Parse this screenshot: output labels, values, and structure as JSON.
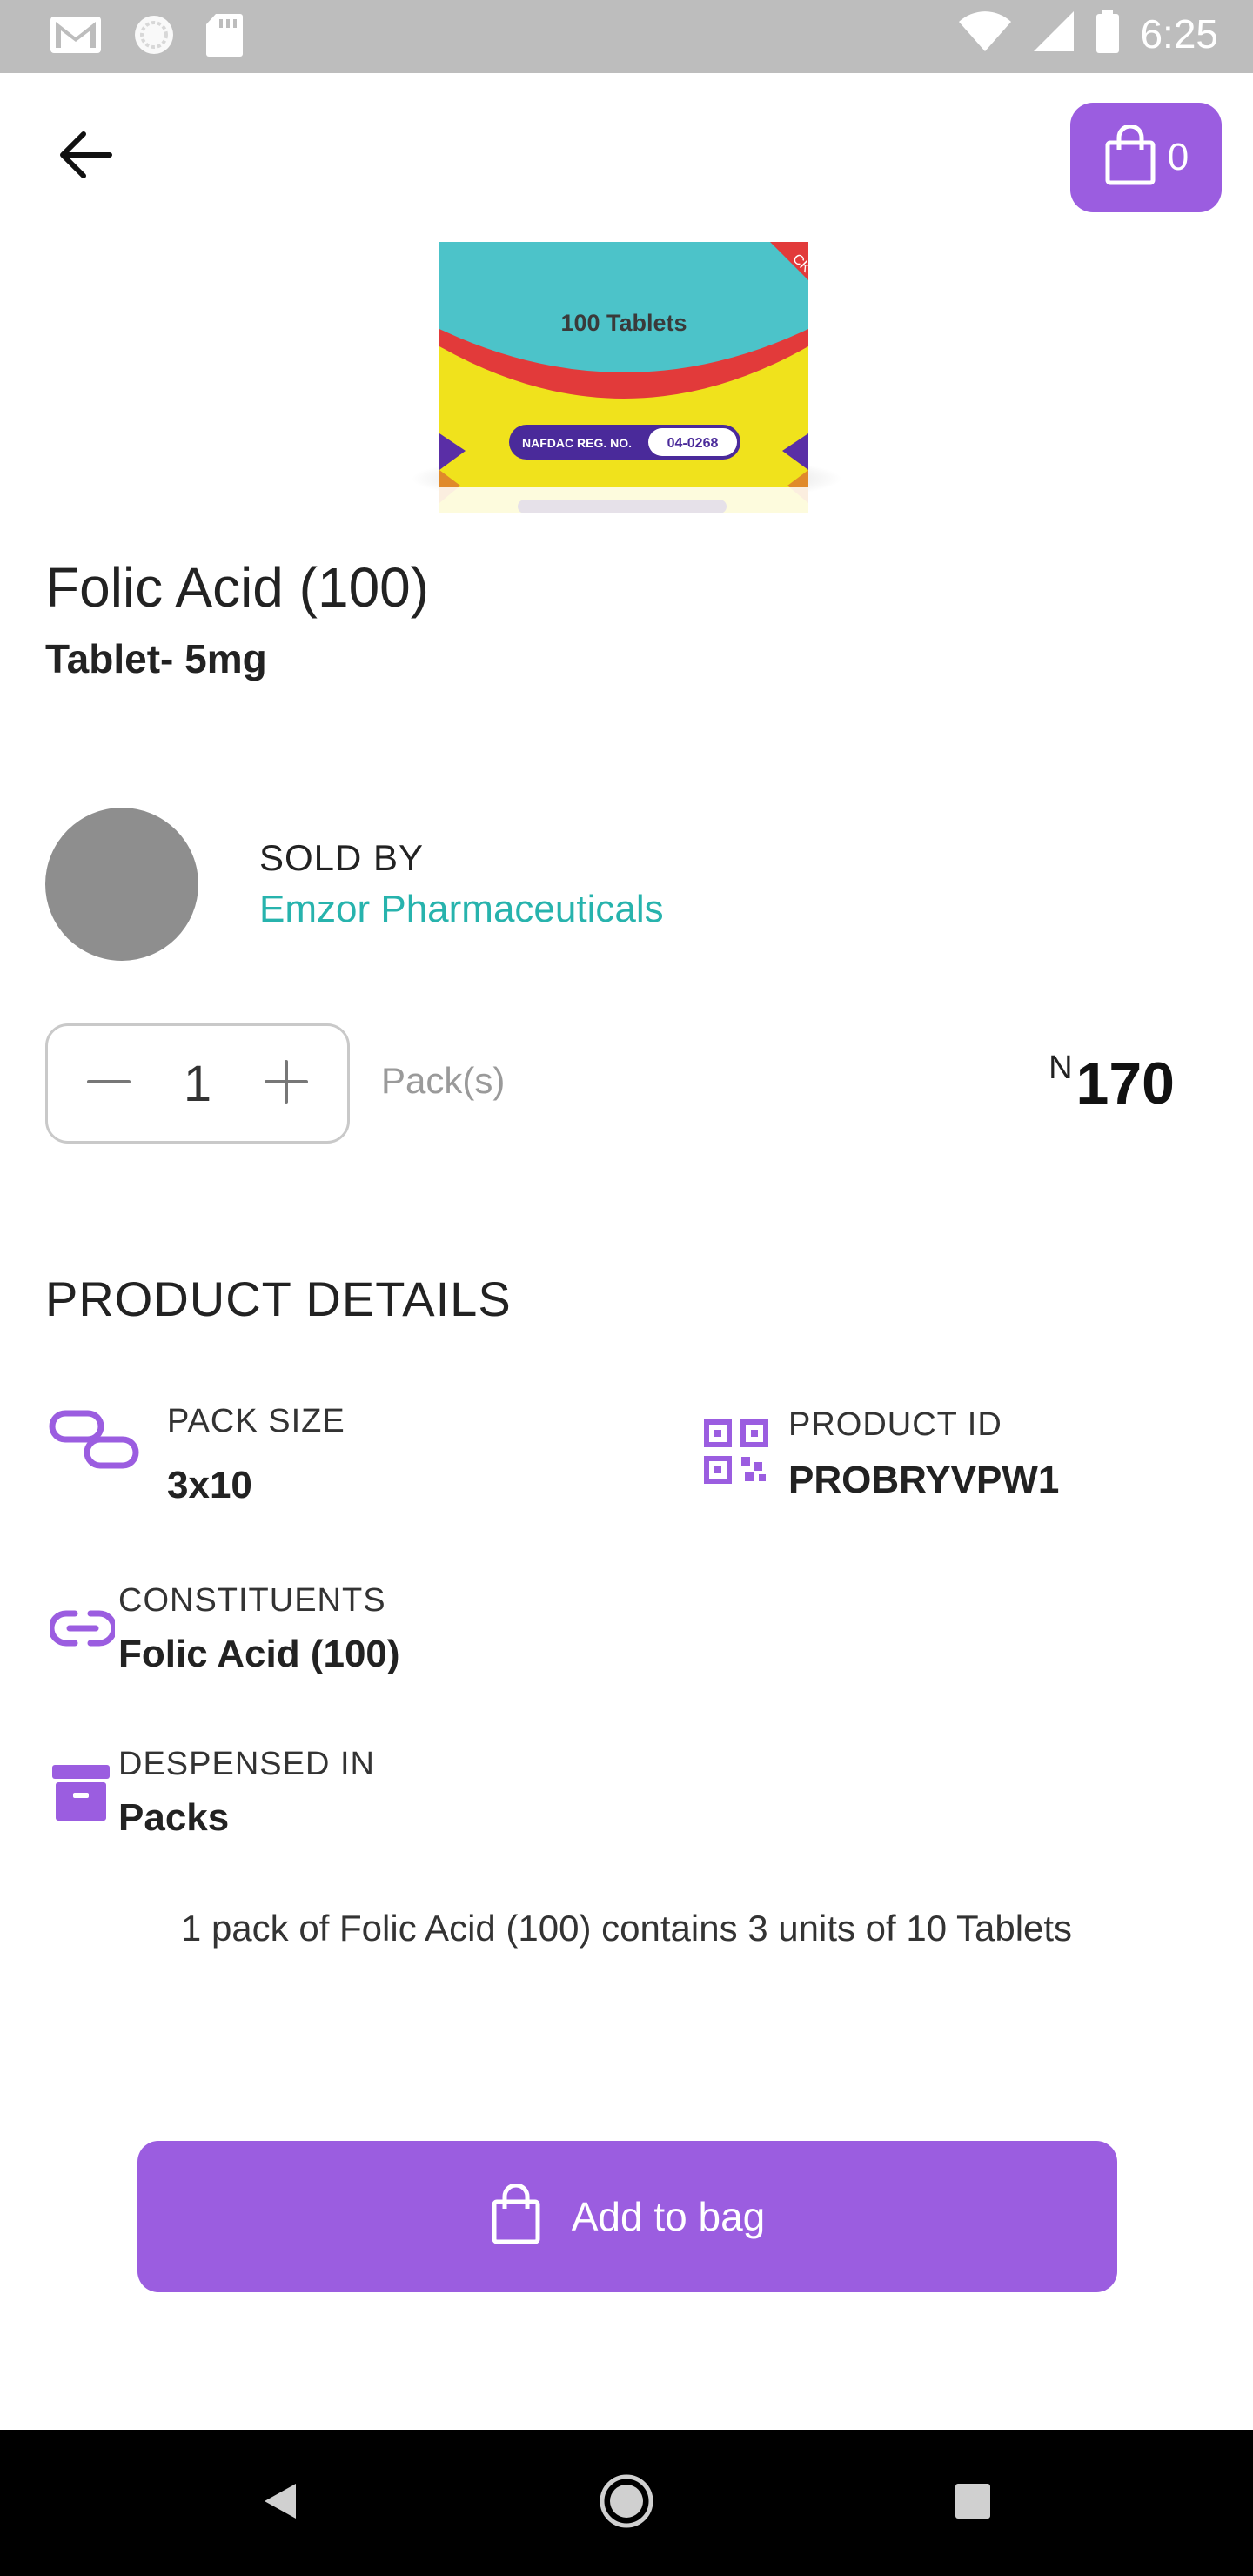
{
  "status_bar": {
    "time": "6:25"
  },
  "header": {
    "cart_count": "0"
  },
  "product": {
    "name": "Folic Acid (100)",
    "form": "Tablet- 5mg",
    "image": {
      "box_text": "100 Tablets",
      "nafdac_label": "NAFDAC REG. NO.",
      "nafdac_number": "04-0268",
      "corner_text": "CK"
    }
  },
  "seller": {
    "label": "SOLD BY",
    "name": "Emzor Pharmaceuticals"
  },
  "order": {
    "quantity": "1",
    "unit": "Pack(s)",
    "currency_symbol": "N",
    "price": "170"
  },
  "details": {
    "heading": "PRODUCT DETAILS",
    "pack_size_label": "PACK SIZE",
    "pack_size_value": "3x10",
    "product_id_label": "PRODUCT ID",
    "product_id_value": "PROBRYVPW1",
    "constituents_label": "CONSTITUENTS",
    "constituents_value": "Folic Acid (100)",
    "dispensed_label": "DESPENSED IN",
    "dispensed_value": "Packs",
    "note": "1 pack of Folic Acid (100) contains 3 units of 10 Tablets"
  },
  "actions": {
    "add_to_bag": "Add to bag"
  },
  "colors": {
    "accent": "#9b5de0",
    "seller_link": "#27b3ad"
  }
}
